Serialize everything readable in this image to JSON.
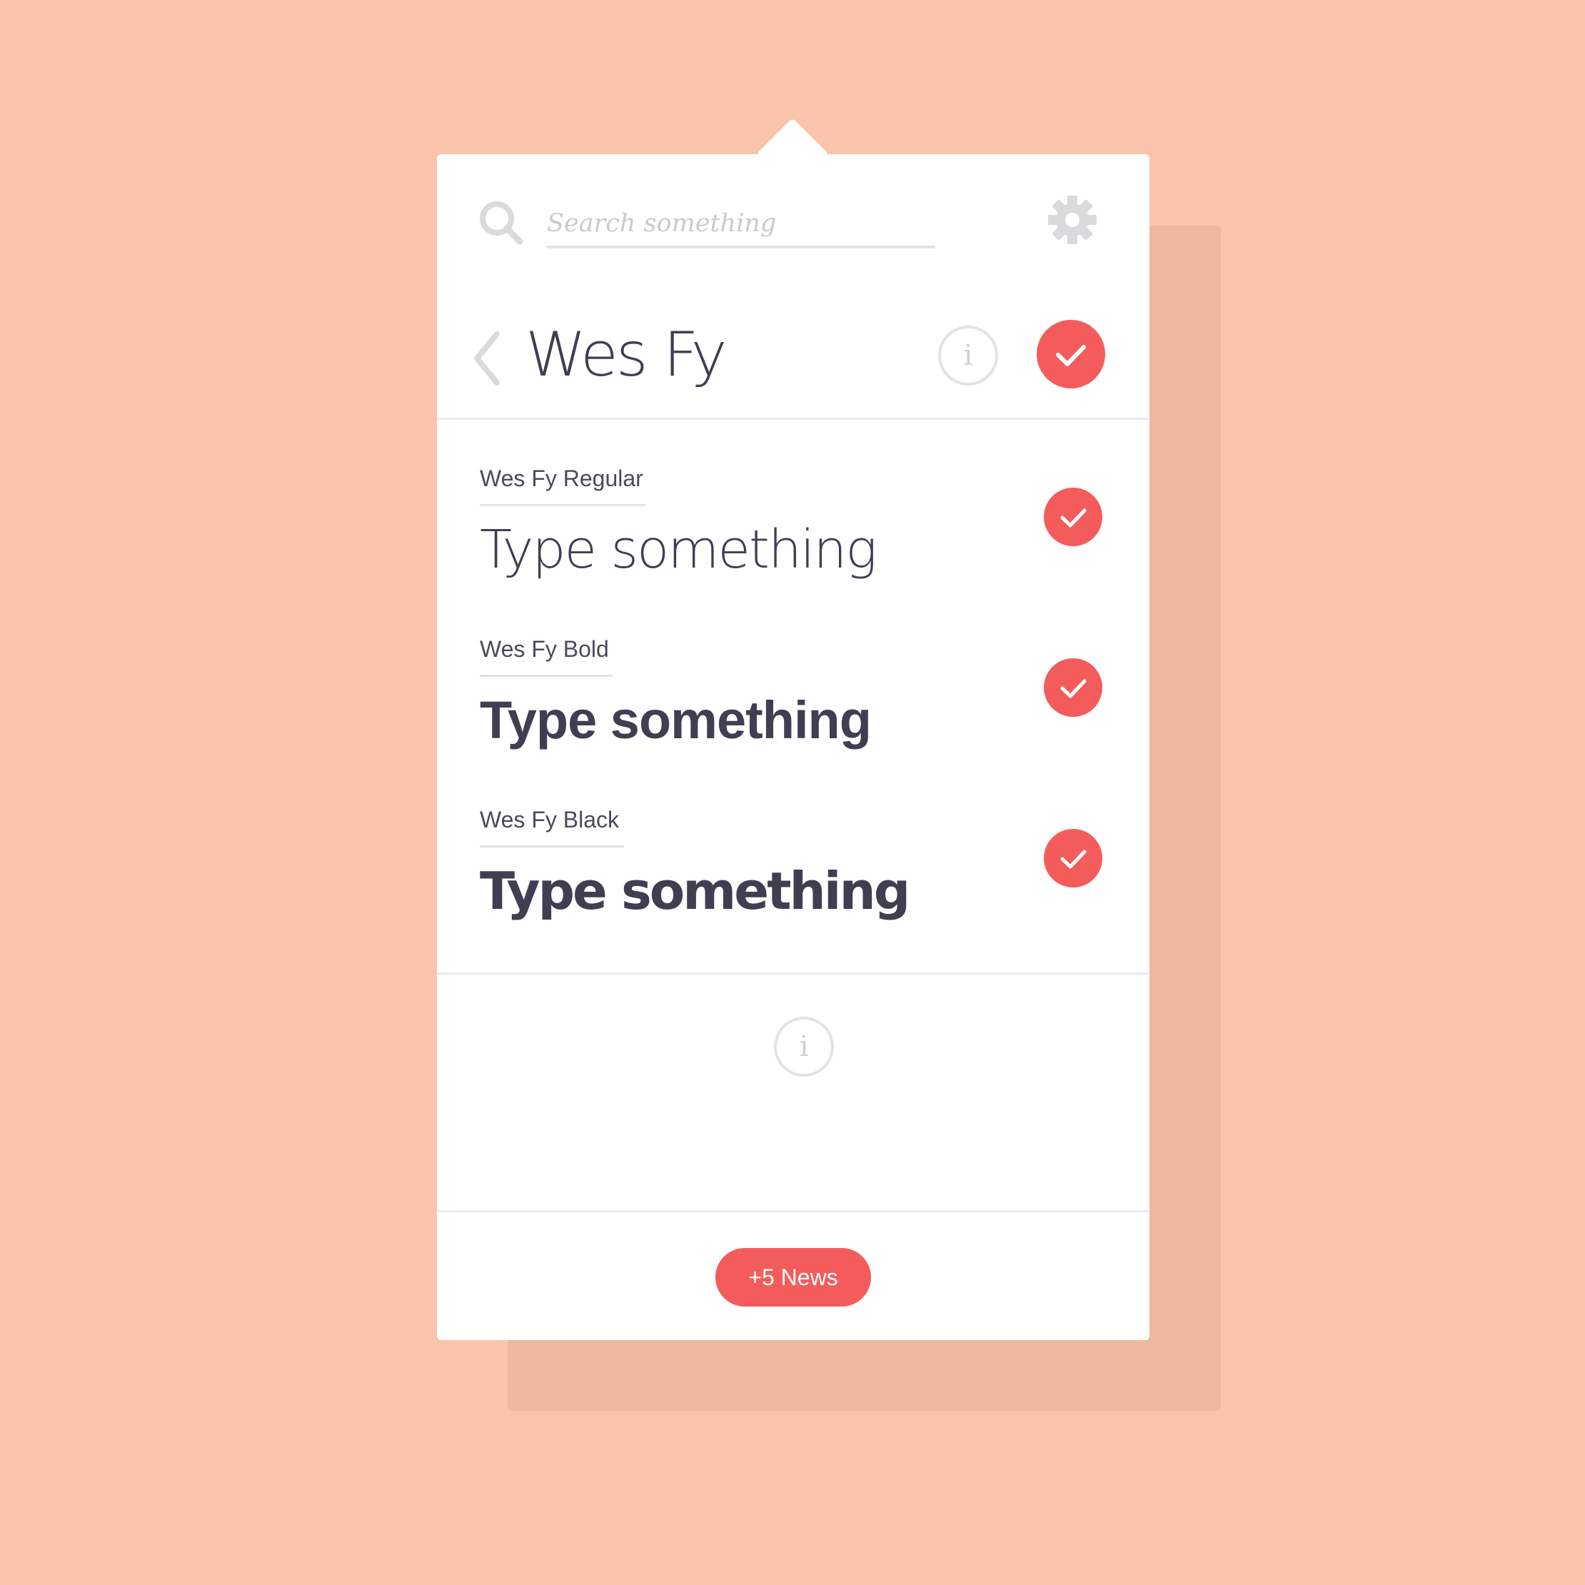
{
  "search": {
    "placeholder": "Search something"
  },
  "header": {
    "title": "Wes Fy",
    "info_glyph": "i"
  },
  "styles": [
    {
      "label": "Wes Fy Regular",
      "sample": "Type something",
      "selected": true
    },
    {
      "label": "Wes Fy Bold",
      "sample": "Type something",
      "selected": true
    },
    {
      "label": "Wes Fy Black",
      "sample": "Type something",
      "selected": true
    }
  ],
  "footer": {
    "info_glyph": "i",
    "news_label": "+5 News"
  },
  "colors": {
    "background": "#f9c4a9",
    "shadow": "#ecb99f",
    "accent": "#f45c5c",
    "text": "#3f3f52",
    "muted": "#c9cace",
    "divider": "#ececee"
  },
  "icons": {
    "search": "search-icon",
    "settings": "gear-icon",
    "back": "chevron-left-icon",
    "info": "info-icon",
    "check": "checkmark-icon"
  }
}
